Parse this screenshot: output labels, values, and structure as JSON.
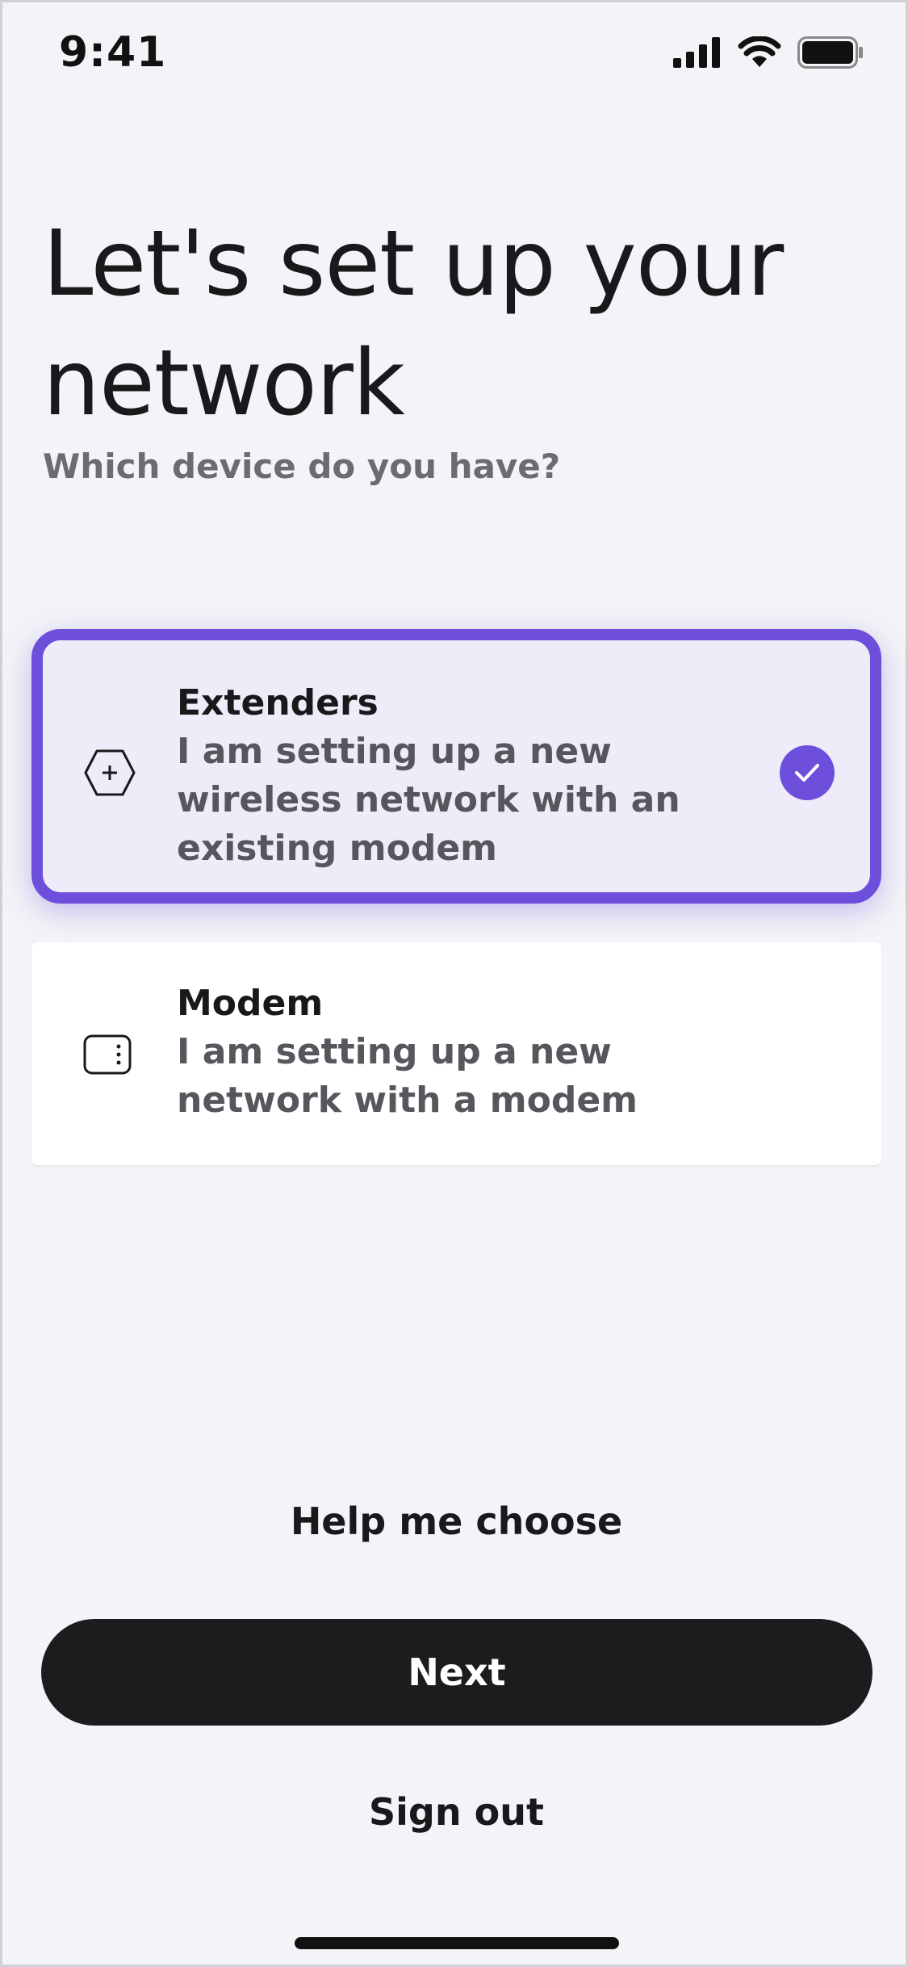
{
  "status_bar": {
    "time": "9:41",
    "icons": [
      "cellular-signal-icon",
      "wifi-icon",
      "battery-icon"
    ]
  },
  "header": {
    "title": "Let's set up your network",
    "subtitle": "Which device do you have?"
  },
  "options": [
    {
      "title": "Extenders",
      "description": "I am setting up a new wireless network with an existing modem",
      "icon": "hexagon-plus-icon",
      "selected": true
    },
    {
      "title": "Modem",
      "description": "I am setting up a new network with a modem",
      "icon": "modem-device-icon",
      "selected": false
    }
  ],
  "actions": {
    "help_label": "Help me choose",
    "next_label": "Next",
    "signout_label": "Sign out"
  },
  "colors": {
    "accent": "#6d4fdc",
    "selected_card_bg": "#efecfa",
    "background": "#f3f4f7",
    "primary_button": "#1b1c1e"
  }
}
